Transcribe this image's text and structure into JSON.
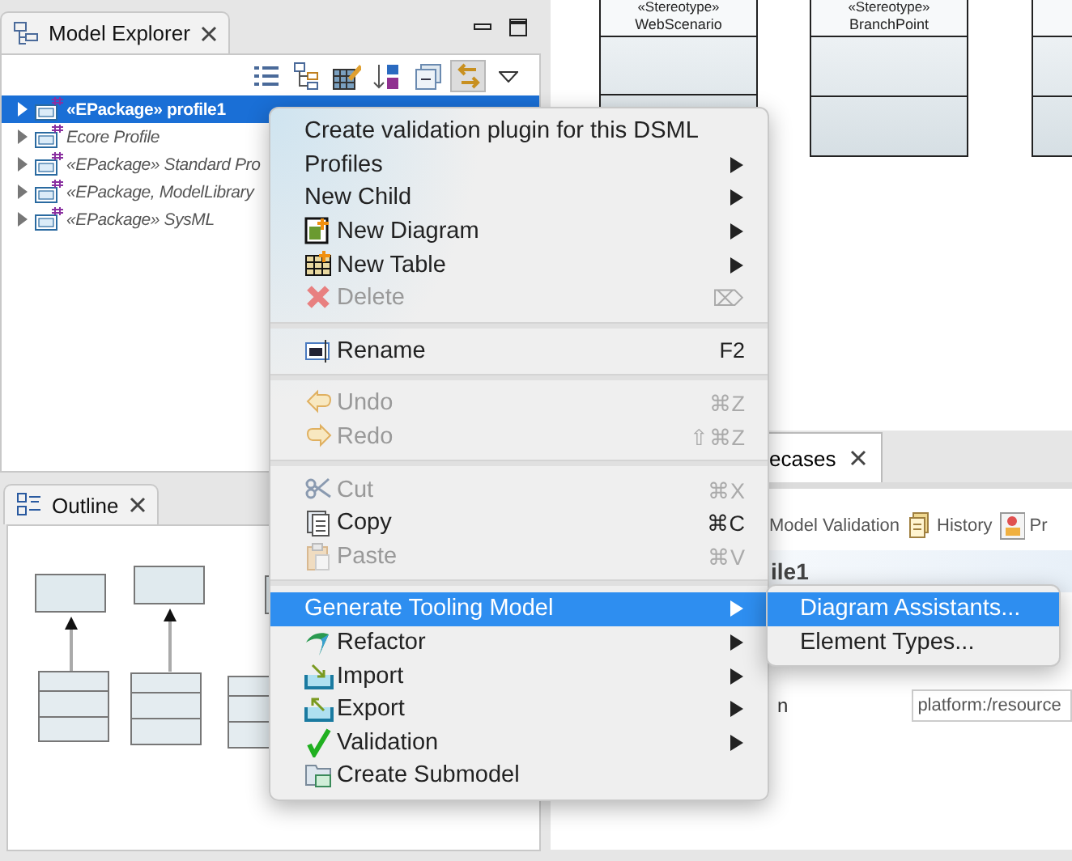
{
  "model_explorer": {
    "title": "Model Explorer",
    "toolbar": [
      {
        "pressed": false
      },
      {
        "pressed": false
      },
      {
        "pressed": false
      },
      {
        "pressed": false
      },
      {
        "pressed": false
      },
      {
        "pressed": true
      },
      {
        "pressed": false
      }
    ],
    "tree": [
      {
        "label": "«EPackage» profile1",
        "selected": true,
        "expanded": false
      },
      {
        "label": "Ecore Profile",
        "selected": false,
        "expanded": false
      },
      {
        "label": "«EPackage» Standard Pro",
        "selected": false,
        "expanded": false
      },
      {
        "label": "«EPackage, ModelLibrary",
        "selected": false,
        "expanded": false
      },
      {
        "label": "«EPackage» SysML",
        "selected": false,
        "expanded": false
      }
    ]
  },
  "diagram": {
    "classes": [
      {
        "stereotype": "«Stereotype»",
        "name": "WebScenario"
      },
      {
        "stereotype": "«Stereotype»",
        "name": "BranchPoint"
      }
    ]
  },
  "outline": {
    "title": "Outline"
  },
  "editor": {
    "tab": "ecases",
    "toolbar": [
      "Model Validation",
      "History",
      "Pr"
    ],
    "heading": "ile1",
    "field_label": "n",
    "field_value": "platform:/resource"
  },
  "context_menu": [
    {
      "kind": "item",
      "label": "Create validation plugin for this DSML",
      "submenu": false,
      "disabled": false,
      "selected": false
    },
    {
      "kind": "item",
      "label": "Profiles",
      "submenu": true,
      "disabled": false,
      "selected": false
    },
    {
      "kind": "item",
      "label": "New Child",
      "submenu": true,
      "disabled": false,
      "selected": false
    },
    {
      "kind": "item",
      "label": "New Diagram",
      "submenu": true,
      "disabled": false,
      "selected": false
    },
    {
      "kind": "item",
      "label": "New Table",
      "submenu": true,
      "disabled": false,
      "selected": false
    },
    {
      "kind": "item",
      "label": "Delete",
      "shortcut": "⌦",
      "submenu": false,
      "disabled": true,
      "selected": false
    },
    {
      "kind": "separator"
    },
    {
      "kind": "item",
      "label": "Rename",
      "shortcut": "F2",
      "submenu": false,
      "disabled": false,
      "selected": false
    },
    {
      "kind": "separator"
    },
    {
      "kind": "item",
      "label": "Undo",
      "shortcut": "⌘Z",
      "submenu": false,
      "disabled": true,
      "selected": false
    },
    {
      "kind": "item",
      "label": "Redo",
      "shortcut": "⇧⌘Z",
      "submenu": false,
      "disabled": true,
      "selected": false
    },
    {
      "kind": "separator"
    },
    {
      "kind": "item",
      "label": "Cut",
      "shortcut": "⌘X",
      "submenu": false,
      "disabled": true,
      "selected": false
    },
    {
      "kind": "item",
      "label": "Copy",
      "shortcut": "⌘C",
      "submenu": false,
      "disabled": false,
      "selected": false
    },
    {
      "kind": "item",
      "label": "Paste",
      "shortcut": "⌘V",
      "submenu": false,
      "disabled": true,
      "selected": false
    },
    {
      "kind": "separator"
    },
    {
      "kind": "item",
      "label": "Generate Tooling Model",
      "submenu": true,
      "disabled": false,
      "selected": true
    },
    {
      "kind": "item",
      "label": "Refactor",
      "submenu": true,
      "disabled": false,
      "selected": false
    },
    {
      "kind": "item",
      "label": "Import",
      "submenu": true,
      "disabled": false,
      "selected": false
    },
    {
      "kind": "item",
      "label": "Export",
      "submenu": true,
      "disabled": false,
      "selected": false
    },
    {
      "kind": "item",
      "label": "Validation",
      "submenu": true,
      "disabled": false,
      "selected": false
    },
    {
      "kind": "item",
      "label": "Create Submodel",
      "submenu": false,
      "disabled": false,
      "selected": false
    }
  ],
  "submenu": [
    {
      "label": "Diagram Assistants...",
      "selected": true
    },
    {
      "label": "Element Types...",
      "selected": false
    }
  ]
}
